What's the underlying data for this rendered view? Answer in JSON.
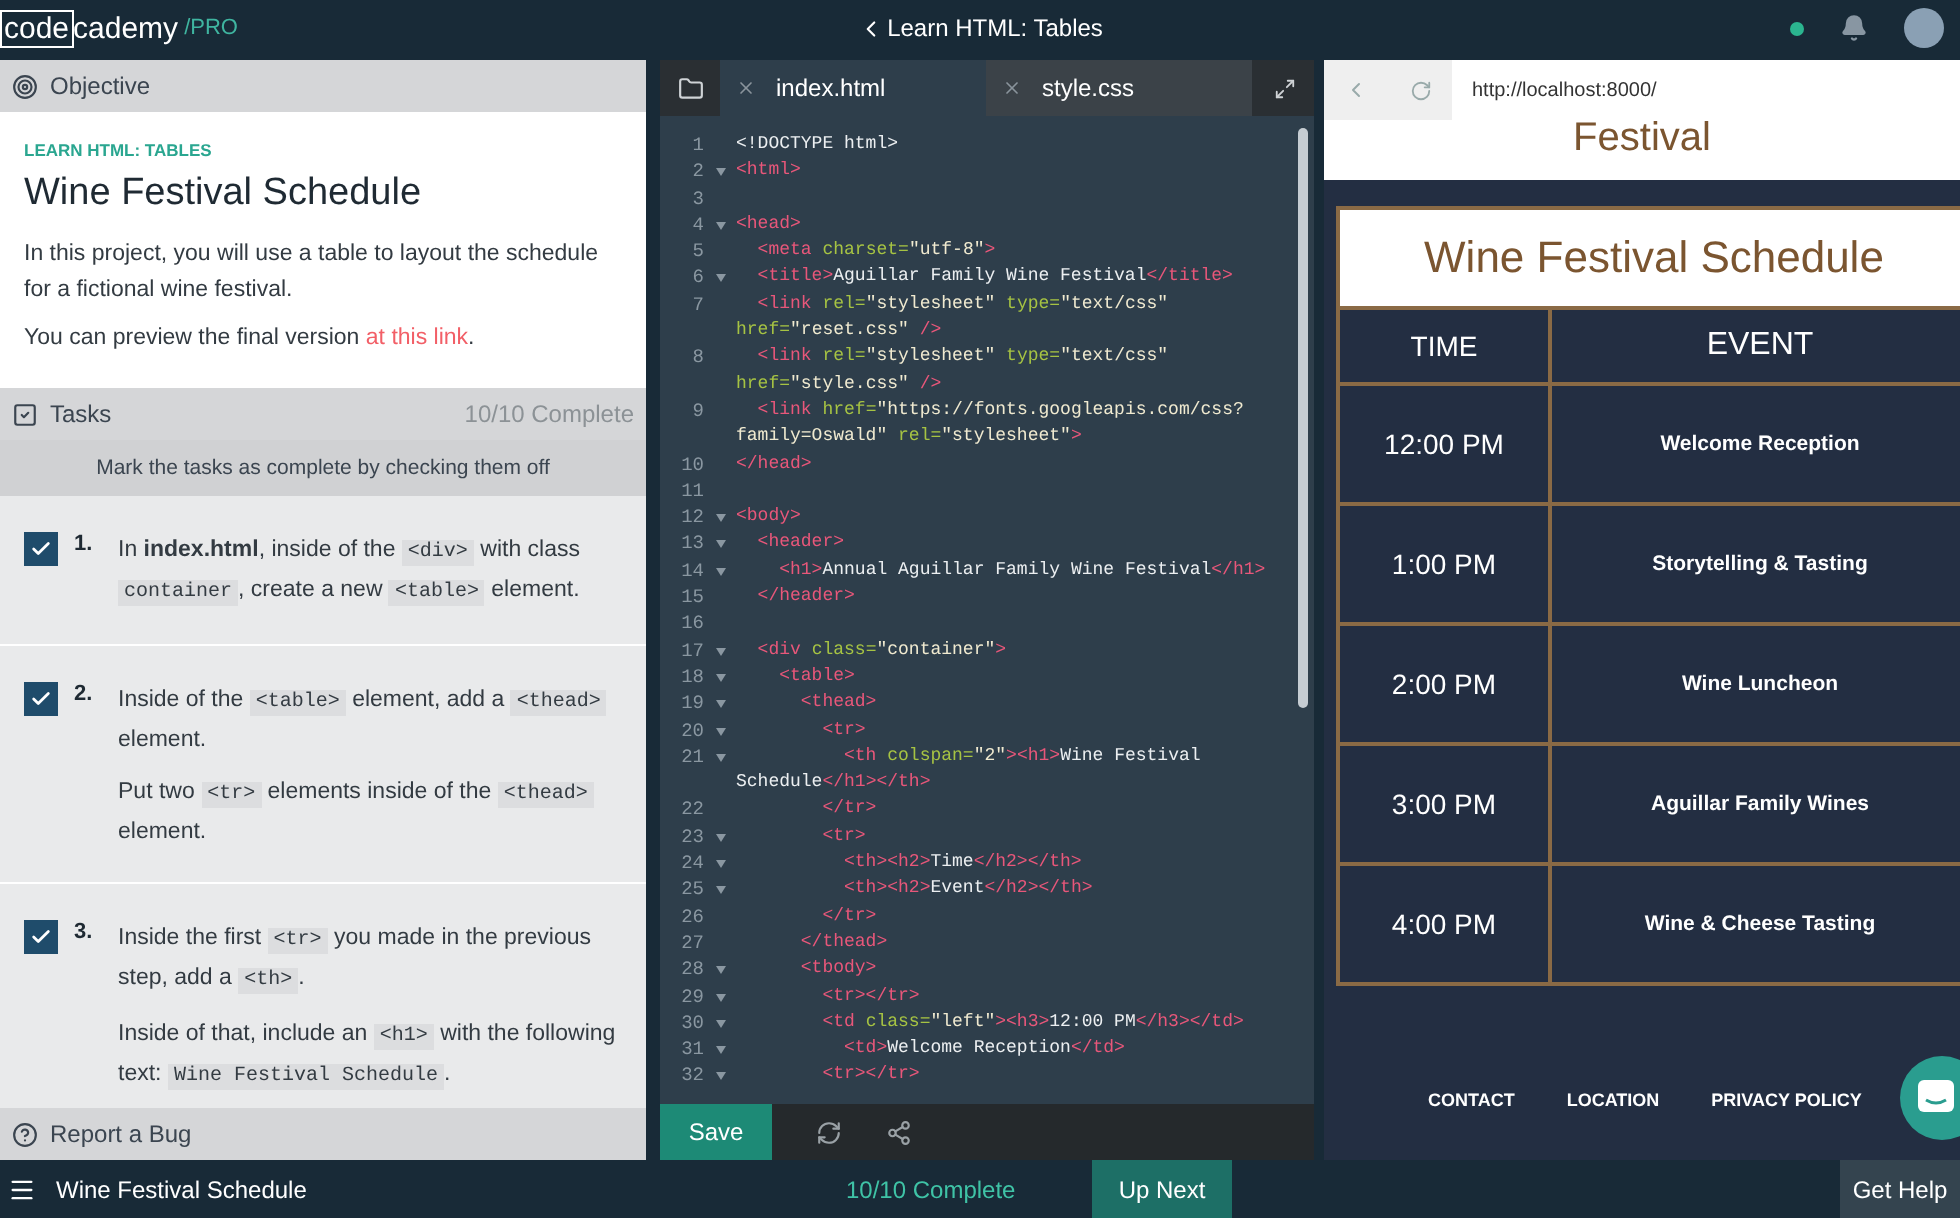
{
  "header": {
    "logo_boxed": "code",
    "logo_rest": "cademy",
    "logo_tier": "/PRO",
    "lesson": "Learn HTML: Tables"
  },
  "objective": {
    "title": "Objective",
    "eyebrow": "LEARN HTML: TABLES",
    "heading": "Wine Festival Schedule",
    "intro": "In this project, you will use a table to layout the schedule for a fictional wine festival.",
    "preview": {
      "before": "You can preview the final version ",
      "link": "at this link",
      "after": "."
    }
  },
  "tasks": {
    "title": "Tasks",
    "progress": "10/10 Complete",
    "hint": "Mark the tasks as complete by checking them off",
    "items": [
      {
        "number": "1.",
        "checked": true,
        "paragraphs": [
          [
            {
              "kind": "text",
              "text": "In "
            },
            {
              "kind": "bold",
              "text": "index.html"
            },
            {
              "kind": "text",
              "text": ", inside of the "
            },
            {
              "kind": "code",
              "text": "<div>"
            },
            {
              "kind": "text",
              "text": " with class "
            },
            {
              "kind": "code",
              "text": "container"
            },
            {
              "kind": "text",
              "text": ", create a new "
            },
            {
              "kind": "code",
              "text": "<table>"
            },
            {
              "kind": "text",
              "text": " element."
            }
          ]
        ]
      },
      {
        "number": "2.",
        "checked": true,
        "paragraphs": [
          [
            {
              "kind": "text",
              "text": "Inside of the "
            },
            {
              "kind": "code",
              "text": "<table>"
            },
            {
              "kind": "text",
              "text": " element, add a "
            },
            {
              "kind": "code",
              "text": "<thead>"
            },
            {
              "kind": "text",
              "text": " element."
            }
          ],
          [
            {
              "kind": "text",
              "text": "Put two "
            },
            {
              "kind": "code",
              "text": "<tr>"
            },
            {
              "kind": "text",
              "text": " elements inside of the "
            },
            {
              "kind": "code",
              "text": "<thead>"
            },
            {
              "kind": "text",
              "text": " element."
            }
          ]
        ]
      },
      {
        "number": "3.",
        "checked": true,
        "paragraphs": [
          [
            {
              "kind": "text",
              "text": "Inside the first "
            },
            {
              "kind": "code",
              "text": "<tr>"
            },
            {
              "kind": "text",
              "text": " you made in the previous step, add a "
            },
            {
              "kind": "code",
              "text": "<th>"
            },
            {
              "kind": "text",
              "text": "."
            }
          ],
          [
            {
              "kind": "text",
              "text": "Inside of that, include an "
            },
            {
              "kind": "code",
              "text": "<h1>"
            },
            {
              "kind": "text",
              "text": " with the following text: "
            },
            {
              "kind": "code",
              "text": "Wine Festival Schedule"
            },
            {
              "kind": "text",
              "text": "."
            }
          ]
        ]
      }
    ]
  },
  "report_bug": "Report a Bug",
  "editor": {
    "tabs": [
      {
        "label": "index.html",
        "selected": true
      },
      {
        "label": "style.css",
        "selected": false
      }
    ],
    "lines": [
      {
        "n": "1",
        "fold": false,
        "seg": [
          {
            "kind": "text",
            "text": "<!DOCTYPE html>"
          }
        ]
      },
      {
        "n": "2",
        "fold": true,
        "seg": [
          {
            "kind": "tag",
            "text": "<html>"
          }
        ]
      },
      {
        "n": "3",
        "fold": false
      },
      {
        "n": "4",
        "fold": true,
        "seg": [
          {
            "kind": "tag",
            "text": "<head>"
          }
        ]
      },
      {
        "n": "5",
        "fold": false,
        "seg": [
          {
            "kind": "tag",
            "text": "  <meta "
          },
          {
            "kind": "attr",
            "text": "charset="
          },
          {
            "kind": "str",
            "text": "\"utf-8\""
          },
          {
            "kind": "tag",
            "text": ">"
          }
        ]
      },
      {
        "n": "6",
        "fold": true,
        "seg": [
          {
            "kind": "tag",
            "text": "  <title>"
          },
          {
            "kind": "text",
            "text": "Aguillar Family Wine Festival"
          },
          {
            "kind": "tag",
            "text": "</title>"
          }
        ]
      },
      {
        "n": "7",
        "fold": false,
        "seg": [
          {
            "kind": "tag",
            "text": "  <link "
          },
          {
            "kind": "attr",
            "text": "rel="
          },
          {
            "kind": "str",
            "text": "\"stylesheet\" "
          },
          {
            "kind": "attr",
            "text": "type="
          },
          {
            "kind": "str",
            "text": "\"text/css\""
          }
        ],
        "wrap": [
          {
            "kind": "attr",
            "text": "href="
          },
          {
            "kind": "str",
            "text": "\"reset.css\""
          },
          {
            "kind": "tag",
            "text": " />"
          }
        ]
      },
      {
        "n": "8",
        "fold": false,
        "seg": [
          {
            "kind": "tag",
            "text": "  <link "
          },
          {
            "kind": "attr",
            "text": "rel="
          },
          {
            "kind": "str",
            "text": "\"stylesheet\" "
          },
          {
            "kind": "attr",
            "text": "type="
          },
          {
            "kind": "str",
            "text": "\"text/css\""
          }
        ],
        "wrap": [
          {
            "kind": "attr",
            "text": "href="
          },
          {
            "kind": "str",
            "text": "\"style.css\""
          },
          {
            "kind": "tag",
            "text": " />"
          }
        ]
      },
      {
        "n": "9",
        "fold": false,
        "seg": [
          {
            "kind": "tag",
            "text": "  <link "
          },
          {
            "kind": "attr",
            "text": "href="
          },
          {
            "kind": "str",
            "text": "\"https://fonts.googleapis.com/css?"
          }
        ],
        "wrap": [
          {
            "kind": "str",
            "text": "family=Oswald\" "
          },
          {
            "kind": "attr",
            "text": "rel="
          },
          {
            "kind": "str",
            "text": "\"stylesheet\""
          },
          {
            "kind": "tag",
            "text": ">"
          }
        ]
      },
      {
        "n": "10",
        "fold": false,
        "seg": [
          {
            "kind": "tag",
            "text": "</head>"
          }
        ]
      },
      {
        "n": "11",
        "fold": false
      },
      {
        "n": "12",
        "fold": true,
        "seg": [
          {
            "kind": "tag",
            "text": "<body>"
          }
        ]
      },
      {
        "n": "13",
        "fold": true,
        "seg": [
          {
            "kind": "tag",
            "text": "  <header>"
          }
        ]
      },
      {
        "n": "14",
        "fold": true,
        "seg": [
          {
            "kind": "tag",
            "text": "    <h1>"
          },
          {
            "kind": "text",
            "text": "Annual Aguillar Family Wine Festival"
          },
          {
            "kind": "tag",
            "text": "</h1>"
          }
        ]
      },
      {
        "n": "15",
        "fold": false,
        "seg": [
          {
            "kind": "tag",
            "text": "  </header>"
          }
        ]
      },
      {
        "n": "16",
        "fold": false
      },
      {
        "n": "17",
        "fold": true,
        "seg": [
          {
            "kind": "tag",
            "text": "  <div "
          },
          {
            "kind": "attr",
            "text": "class="
          },
          {
            "kind": "str",
            "text": "\"container\""
          },
          {
            "kind": "tag",
            "text": ">"
          }
        ]
      },
      {
        "n": "18",
        "fold": true,
        "seg": [
          {
            "kind": "tag",
            "text": "    <table>"
          }
        ]
      },
      {
        "n": "19",
        "fold": true,
        "seg": [
          {
            "kind": "tag",
            "text": "      <thead>"
          }
        ]
      },
      {
        "n": "20",
        "fold": true,
        "seg": [
          {
            "kind": "tag",
            "text": "        <tr>"
          }
        ]
      },
      {
        "n": "21",
        "fold": true,
        "seg": [
          {
            "kind": "tag",
            "text": "          <th "
          },
          {
            "kind": "attr",
            "text": "colspan="
          },
          {
            "kind": "str",
            "text": "\"2\""
          },
          {
            "kind": "tag",
            "text": "><h1>"
          },
          {
            "kind": "text",
            "text": "Wine Festival"
          }
        ],
        "wrap": [
          {
            "kind": "text",
            "text": "Schedule"
          },
          {
            "kind": "tag",
            "text": "</h1></th>"
          }
        ]
      },
      {
        "n": "22",
        "fold": false,
        "seg": [
          {
            "kind": "tag",
            "text": "        </tr>"
          }
        ]
      },
      {
        "n": "23",
        "fold": true,
        "seg": [
          {
            "kind": "tag",
            "text": "        <tr>"
          }
        ]
      },
      {
        "n": "24",
        "fold": true,
        "seg": [
          {
            "kind": "tag",
            "text": "          <th><h2>"
          },
          {
            "kind": "text",
            "text": "Time"
          },
          {
            "kind": "tag",
            "text": "</h2></th>"
          }
        ]
      },
      {
        "n": "25",
        "fold": true,
        "seg": [
          {
            "kind": "tag",
            "text": "          <th><h2>"
          },
          {
            "kind": "text",
            "text": "Event"
          },
          {
            "kind": "tag",
            "text": "</h2></th>"
          }
        ]
      },
      {
        "n": "26",
        "fold": false,
        "seg": [
          {
            "kind": "tag",
            "text": "        </tr>"
          }
        ]
      },
      {
        "n": "27",
        "fold": false,
        "seg": [
          {
            "kind": "tag",
            "text": "      </thead>"
          }
        ]
      },
      {
        "n": "28",
        "fold": true,
        "seg": [
          {
            "kind": "tag",
            "text": "      <tbody>"
          }
        ]
      },
      {
        "n": "29",
        "fold": true,
        "seg": [
          {
            "kind": "tag",
            "text": "        <tr></tr>"
          }
        ]
      },
      {
        "n": "30",
        "fold": true,
        "seg": [
          {
            "kind": "tag",
            "text": "        <td "
          },
          {
            "kind": "attr",
            "text": "class="
          },
          {
            "kind": "str",
            "text": "\"left\""
          },
          {
            "kind": "tag",
            "text": "><h3>"
          },
          {
            "kind": "text",
            "text": "12:00 PM"
          },
          {
            "kind": "tag",
            "text": "</h3></td>"
          }
        ]
      },
      {
        "n": "31",
        "fold": true,
        "seg": [
          {
            "kind": "tag",
            "text": "          <td>"
          },
          {
            "kind": "text",
            "text": "Welcome Reception"
          },
          {
            "kind": "tag",
            "text": "</td>"
          }
        ]
      },
      {
        "n": "32",
        "fold": true,
        "seg": [
          {
            "kind": "tag",
            "text": "        <tr></tr>"
          }
        ]
      }
    ],
    "save": "Save"
  },
  "preview": {
    "url": "http://localhost:8000/",
    "header_text": "Festival",
    "table_title": "Wine Festival Schedule",
    "columns": [
      "TIME",
      "EVENT"
    ],
    "rows": [
      {
        "time": "12:00 PM",
        "event": "Welcome Reception"
      },
      {
        "time": "1:00 PM",
        "event": "Storytelling & Tasting"
      },
      {
        "time": "2:00 PM",
        "event": "Wine Luncheon"
      },
      {
        "time": "3:00 PM",
        "event": "Aguillar Family Wines"
      },
      {
        "time": "4:00 PM",
        "event": "Wine & Cheese Tasting"
      }
    ],
    "footer_links": [
      "CONTACT",
      "LOCATION",
      "PRIVACY POLICY"
    ]
  },
  "bottom_bar": {
    "title": "Wine Festival Schedule",
    "progress": "10/10 Complete",
    "next": "Up Next",
    "help": "Get Help"
  }
}
